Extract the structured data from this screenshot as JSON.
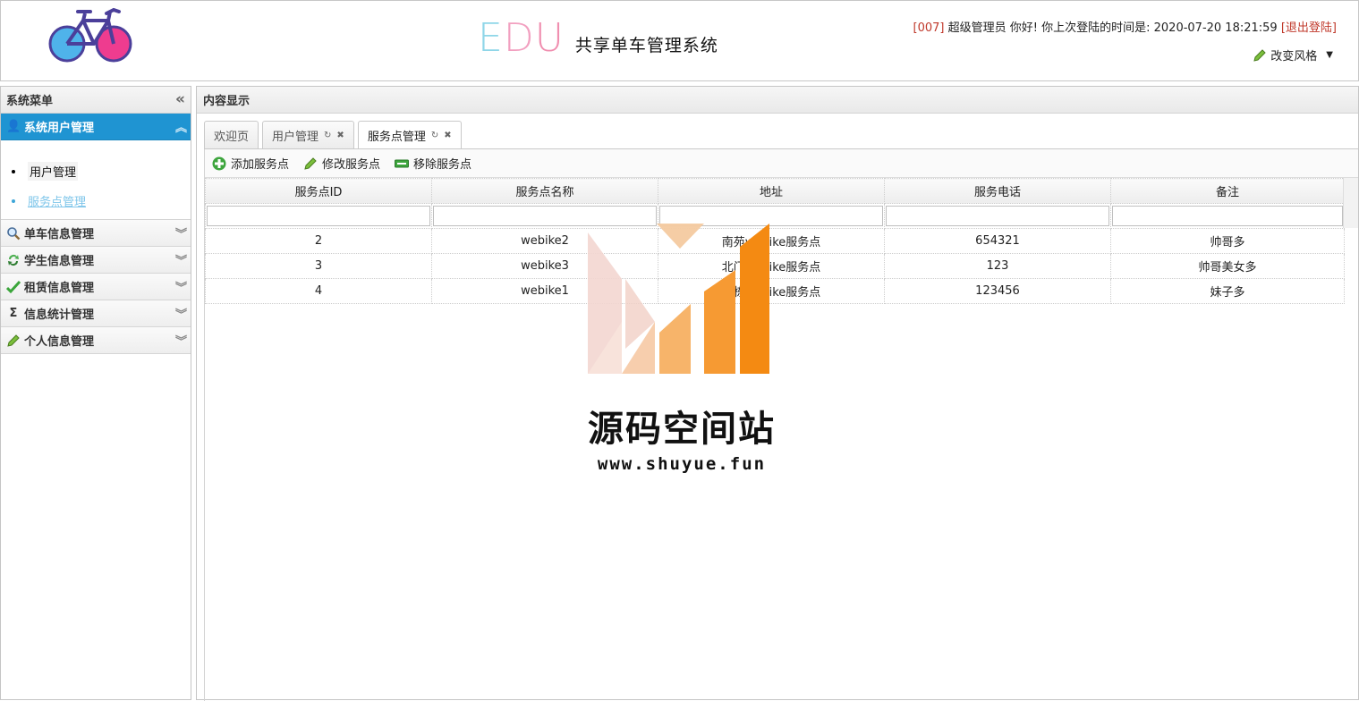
{
  "header": {
    "logo_alt": "bicycle-logo",
    "edu_letters": [
      "E",
      "D",
      "U"
    ],
    "system_title": "共享单车管理系统",
    "user_id": "[007]",
    "user_greeting": "超级管理员 你好! 你上次登陆的时间是:",
    "last_login": "2020-07-20 18:21:59",
    "logout_label": "[退出登陆]",
    "style_label": "改变风格"
  },
  "sidebar": {
    "title": "系统菜单",
    "groups": [
      {
        "label": "系统用户管理",
        "icon": "user-icon",
        "active": true,
        "items": [
          {
            "label": "用户管理"
          },
          {
            "label": "服务点管理"
          }
        ]
      },
      {
        "label": "单车信息管理",
        "icon": "search-icon"
      },
      {
        "label": "学生信息管理",
        "icon": "refresh-icon"
      },
      {
        "label": "租赁信息管理",
        "icon": "check-icon"
      },
      {
        "label": "信息统计管理",
        "icon": "sigma-icon"
      },
      {
        "label": "个人信息管理",
        "icon": "pencil-icon"
      }
    ]
  },
  "content": {
    "title": "内容显示",
    "tabs": [
      {
        "label": "欢迎页"
      },
      {
        "label": "用户管理"
      },
      {
        "label": "服务点管理"
      }
    ],
    "toolbar": {
      "add": "添加服务点",
      "edit": "修改服务点",
      "remove": "移除服务点"
    },
    "table": {
      "columns": [
        "服务点ID",
        "服务点名称",
        "地址",
        "服务电话",
        "备注"
      ],
      "rows": [
        [
          "2",
          "webike2",
          "南苑webike服务点",
          "654321",
          "帅哥多"
        ],
        [
          "3",
          "webike3",
          "北门webike服务点",
          "123",
          "帅哥美女多"
        ],
        [
          "4",
          "webike1",
          "一栋webike服务点",
          "123456",
          "妹子多"
        ]
      ]
    }
  },
  "watermark": {
    "text": "源码空间站",
    "url": "www.shuyue.fun"
  },
  "colors": {
    "accent": "#1f94d2",
    "logout_red": "#c0392b",
    "link_blue": "#7fc6ea"
  }
}
